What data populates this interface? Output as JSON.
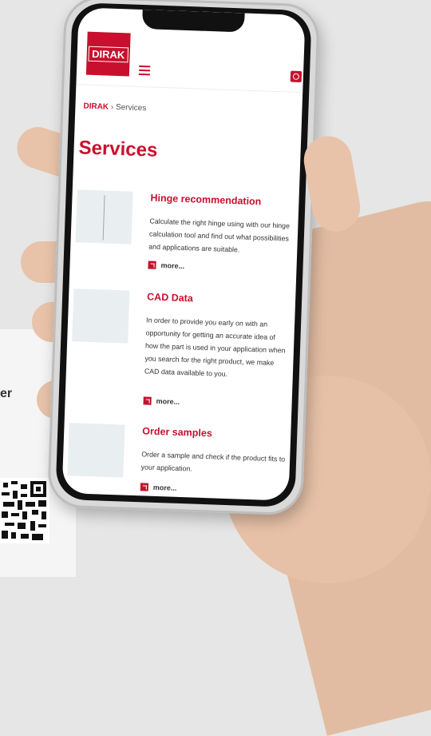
{
  "side_card": {
    "text_fragment": "er"
  },
  "site": {
    "logo_text": "DIRAK",
    "breadcrumb": {
      "home": "DIRAK",
      "separator": "›",
      "current": "Services"
    },
    "page_title": "Services"
  },
  "services": [
    {
      "title": "Hinge recommendation",
      "description": "Calculate the right hinge using with our hinge calculation tool and find out what possibilities and applications are suitable.",
      "more": "more..."
    },
    {
      "title": "CAD Data",
      "description": "In order to provide you early on with an opportunity for getting an accurate idea of how the part is used in your application when you search for the right product, we make CAD data available to you.",
      "more": "more..."
    },
    {
      "title": "Order samples",
      "description": "Order a sample and check if the product fits to your application.",
      "more": "more..."
    }
  ],
  "colors": {
    "brand_red": "#c8102e",
    "background": "#e6e6e6"
  },
  "icons": {
    "menu": "hamburger-menu-icon",
    "search": "search-icon",
    "more": "arrow-up-right-icon"
  }
}
